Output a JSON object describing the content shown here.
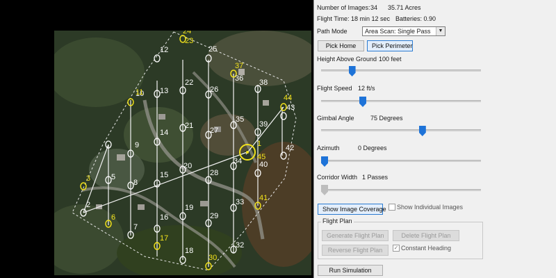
{
  "stats": {
    "images_label": "Number of Images:",
    "images_value": "34",
    "acres": "35.71 Acres",
    "flight_time": "Flight Time: 18 min 12 sec",
    "batteries": "Batteries: 0.90"
  },
  "path_mode": {
    "label": "Path Mode",
    "value": "Area Scan: Single Pass"
  },
  "buttons": {
    "pick_home": "Pick Home",
    "pick_perimeter": "Pick Perimeter",
    "show_coverage": "Show Image Coverage",
    "run_simulation": "Run Simulation"
  },
  "sliders": {
    "height": {
      "label": "Height Above Ground",
      "value": "100 feet",
      "level": 0.18
    },
    "speed": {
      "label": "Flight Speed",
      "value": "12 ft/s",
      "level": 0.25
    },
    "gimbal": {
      "label": "Gimbal Angle",
      "value": "75 Degrees",
      "level": 0.64
    },
    "azimuth": {
      "label": "Azimuth",
      "value": "0 Degrees",
      "level": 0.0
    },
    "corridor": {
      "label": "Corridor Width",
      "value": "1 Passes",
      "level": 0.0
    }
  },
  "show_individual": {
    "label": "Show Individual Images",
    "checked": false
  },
  "flight_plan": {
    "title": "Flight Plan",
    "generate": "Generate Flight Plan",
    "delete": "Delete Flight Plan",
    "reverse": "Reverse Flight Plan",
    "constant_heading": "Constant Heading",
    "constant_checked": true
  },
  "map": {
    "waypoints": [
      {
        "n": "1",
        "color": "yellow"
      },
      {
        "n": "2",
        "color": "white"
      },
      {
        "n": "3",
        "color": "yellow"
      },
      {
        "n": "5",
        "color": "white"
      },
      {
        "n": "6",
        "color": "yellow"
      },
      {
        "n": "7",
        "color": "white"
      },
      {
        "n": "8",
        "color": "white"
      },
      {
        "n": "9",
        "color": "white"
      },
      {
        "n": "10",
        "color": "white"
      },
      {
        "n": "11",
        "color": "yellow"
      },
      {
        "n": "12",
        "color": "white"
      },
      {
        "n": "13",
        "color": "white"
      },
      {
        "n": "14",
        "color": "white"
      },
      {
        "n": "15",
        "color": "white"
      },
      {
        "n": "16",
        "color": "white"
      },
      {
        "n": "17",
        "color": "yellow"
      },
      {
        "n": "18",
        "color": "white"
      },
      {
        "n": "19",
        "color": "white"
      },
      {
        "n": "20",
        "color": "white"
      },
      {
        "n": "21",
        "color": "white"
      },
      {
        "n": "22",
        "color": "white"
      },
      {
        "n": "23",
        "color": "yellow"
      },
      {
        "n": "24",
        "color": "yellow"
      },
      {
        "n": "25",
        "color": "white"
      },
      {
        "n": "26",
        "color": "white"
      },
      {
        "n": "27",
        "color": "white"
      },
      {
        "n": "28",
        "color": "white"
      },
      {
        "n": "29",
        "color": "white"
      },
      {
        "n": "30",
        "color": "yellow"
      },
      {
        "n": "32",
        "color": "white"
      },
      {
        "n": "33",
        "color": "white"
      },
      {
        "n": "34",
        "color": "white"
      },
      {
        "n": "35",
        "color": "white"
      },
      {
        "n": "36",
        "color": "white"
      },
      {
        "n": "37",
        "color": "yellow"
      },
      {
        "n": "38",
        "color": "white"
      },
      {
        "n": "39",
        "color": "white"
      },
      {
        "n": "40",
        "color": "white"
      },
      {
        "n": "41",
        "color": "yellow"
      },
      {
        "n": "42",
        "color": "white"
      },
      {
        "n": "43",
        "color": "white"
      },
      {
        "n": "44",
        "color": "yellow"
      },
      {
        "n": "45",
        "color": "yellow"
      }
    ],
    "home_marker": {
      "color": "yellow"
    }
  }
}
